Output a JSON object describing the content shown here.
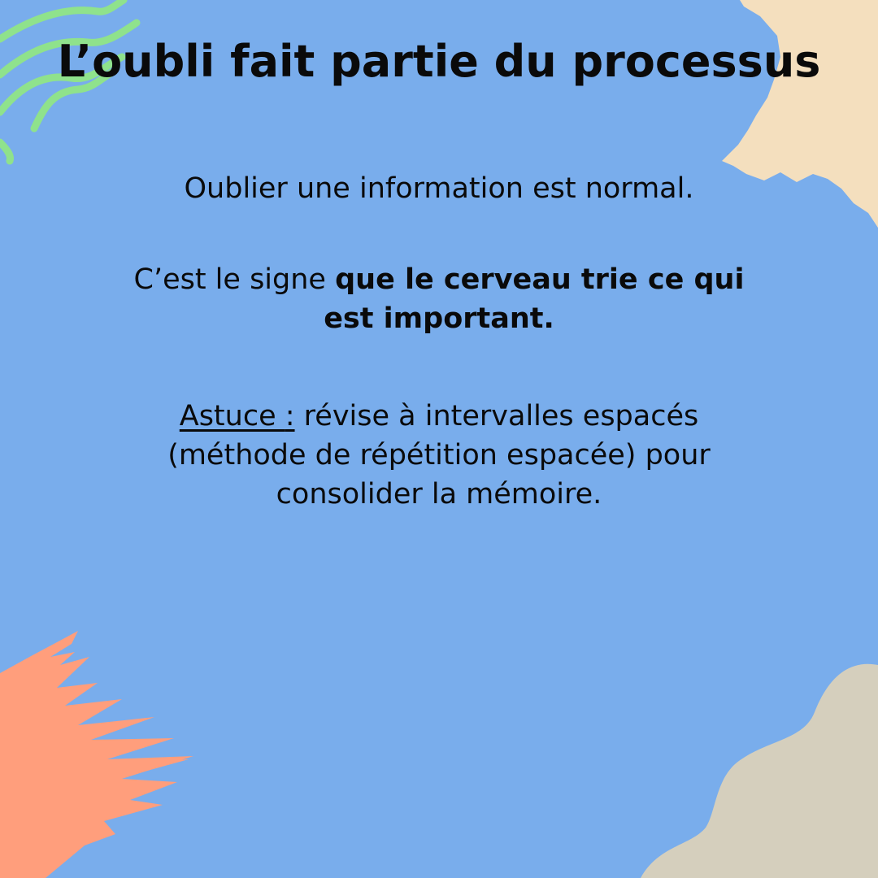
{
  "colors": {
    "background": "#79adec",
    "green_waves": "#8fe28c",
    "beige_brush": "#f4dfbe",
    "salmon_brush": "#ff9e7c",
    "taupe_blob": "#d5cfbd",
    "text": "#0a0a0a"
  },
  "title": "L’oubli fait partie du processus",
  "paragraph1": "Oublier une information est normal.",
  "paragraph2": {
    "prefix": "C’est le signe ",
    "bold": "que le cerveau trie ce qui est important."
  },
  "paragraph3": {
    "tip_label": "Astuce ",
    "colon": ":",
    "rest": " révise à intervalles espacés (méthode de répétition espacée) pour consolider la mémoire."
  },
  "decorations": [
    "green-wave-lines",
    "beige-brush-stroke",
    "salmon-brush-stroke",
    "taupe-blob"
  ]
}
